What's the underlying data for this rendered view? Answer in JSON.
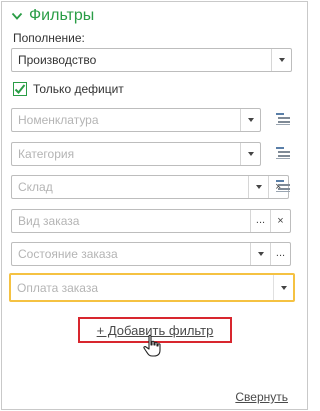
{
  "header": {
    "title": "Фильтры",
    "chevron_icon": "chevron-down-icon"
  },
  "replenishment": {
    "label": "Пополнение:",
    "value": "Производство"
  },
  "deficit": {
    "label": "Только дефицит",
    "checked": true
  },
  "filters": {
    "nomenclature": {
      "placeholder": "Номенклатура"
    },
    "category": {
      "placeholder": "Категория"
    },
    "warehouse": {
      "placeholder": "Склад"
    },
    "order_type": {
      "placeholder": "Вид заказа"
    },
    "order_state": {
      "placeholder": "Состояние заказа"
    },
    "order_payment": {
      "placeholder": "Оплата заказа"
    }
  },
  "buttons": {
    "more": "...",
    "clear": "×",
    "add_filter": "+ Добавить фильтр",
    "collapse": "Свернуть"
  },
  "colors": {
    "accent": "#2a9d46",
    "highlight_border": "#d8262e",
    "focus_border": "#f5c242",
    "placeholder": "#b4b4b4"
  }
}
